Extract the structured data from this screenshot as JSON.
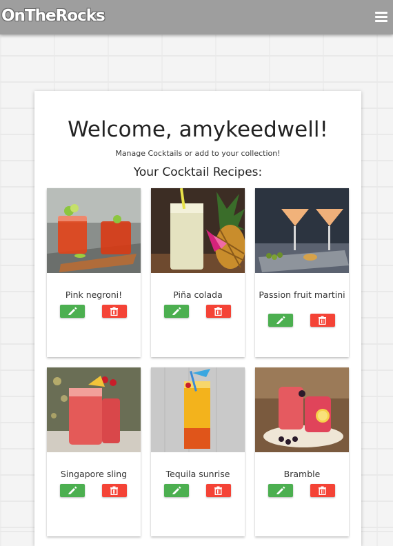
{
  "navbar": {
    "brand": "OnTheRocks"
  },
  "page": {
    "welcome": "Welcome, amykeedwell!",
    "subtitle": "Manage Cocktails or add to your collection!",
    "section_title": "Your Cocktail Recipes:"
  },
  "cocktails": [
    {
      "name": "Pink negroni!"
    },
    {
      "name": "Piña colada"
    },
    {
      "name": "Passion fruit martini"
    },
    {
      "name": "Singapore sling"
    },
    {
      "name": "Tequila sunrise"
    },
    {
      "name": "Bramble"
    }
  ],
  "colors": {
    "navbar": "#9e9e9e",
    "edit_button": "#4caf50",
    "delete_button": "#f44336"
  },
  "icons": {
    "menu": "hamburger-icon",
    "edit": "pencil-icon",
    "delete": "trash-icon"
  }
}
